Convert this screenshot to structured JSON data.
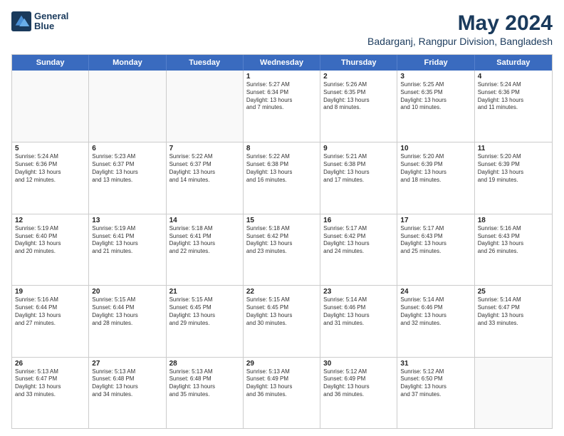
{
  "logo": {
    "line1": "General",
    "line2": "Blue"
  },
  "title": "May 2024",
  "subtitle": "Badarganj, Rangpur Division, Bangladesh",
  "header_days": [
    "Sunday",
    "Monday",
    "Tuesday",
    "Wednesday",
    "Thursday",
    "Friday",
    "Saturday"
  ],
  "weeks": [
    [
      {
        "day": "",
        "lines": [],
        "empty": true
      },
      {
        "day": "",
        "lines": [],
        "empty": true
      },
      {
        "day": "",
        "lines": [],
        "empty": true
      },
      {
        "day": "1",
        "lines": [
          "Sunrise: 5:27 AM",
          "Sunset: 6:34 PM",
          "Daylight: 13 hours",
          "and 7 minutes."
        ],
        "empty": false
      },
      {
        "day": "2",
        "lines": [
          "Sunrise: 5:26 AM",
          "Sunset: 6:35 PM",
          "Daylight: 13 hours",
          "and 8 minutes."
        ],
        "empty": false
      },
      {
        "day": "3",
        "lines": [
          "Sunrise: 5:25 AM",
          "Sunset: 6:35 PM",
          "Daylight: 13 hours",
          "and 10 minutes."
        ],
        "empty": false
      },
      {
        "day": "4",
        "lines": [
          "Sunrise: 5:24 AM",
          "Sunset: 6:36 PM",
          "Daylight: 13 hours",
          "and 11 minutes."
        ],
        "empty": false
      }
    ],
    [
      {
        "day": "5",
        "lines": [
          "Sunrise: 5:24 AM",
          "Sunset: 6:36 PM",
          "Daylight: 13 hours",
          "and 12 minutes."
        ],
        "empty": false
      },
      {
        "day": "6",
        "lines": [
          "Sunrise: 5:23 AM",
          "Sunset: 6:37 PM",
          "Daylight: 13 hours",
          "and 13 minutes."
        ],
        "empty": false
      },
      {
        "day": "7",
        "lines": [
          "Sunrise: 5:22 AM",
          "Sunset: 6:37 PM",
          "Daylight: 13 hours",
          "and 14 minutes."
        ],
        "empty": false
      },
      {
        "day": "8",
        "lines": [
          "Sunrise: 5:22 AM",
          "Sunset: 6:38 PM",
          "Daylight: 13 hours",
          "and 16 minutes."
        ],
        "empty": false
      },
      {
        "day": "9",
        "lines": [
          "Sunrise: 5:21 AM",
          "Sunset: 6:38 PM",
          "Daylight: 13 hours",
          "and 17 minutes."
        ],
        "empty": false
      },
      {
        "day": "10",
        "lines": [
          "Sunrise: 5:20 AM",
          "Sunset: 6:39 PM",
          "Daylight: 13 hours",
          "and 18 minutes."
        ],
        "empty": false
      },
      {
        "day": "11",
        "lines": [
          "Sunrise: 5:20 AM",
          "Sunset: 6:39 PM",
          "Daylight: 13 hours",
          "and 19 minutes."
        ],
        "empty": false
      }
    ],
    [
      {
        "day": "12",
        "lines": [
          "Sunrise: 5:19 AM",
          "Sunset: 6:40 PM",
          "Daylight: 13 hours",
          "and 20 minutes."
        ],
        "empty": false
      },
      {
        "day": "13",
        "lines": [
          "Sunrise: 5:19 AM",
          "Sunset: 6:41 PM",
          "Daylight: 13 hours",
          "and 21 minutes."
        ],
        "empty": false
      },
      {
        "day": "14",
        "lines": [
          "Sunrise: 5:18 AM",
          "Sunset: 6:41 PM",
          "Daylight: 13 hours",
          "and 22 minutes."
        ],
        "empty": false
      },
      {
        "day": "15",
        "lines": [
          "Sunrise: 5:18 AM",
          "Sunset: 6:42 PM",
          "Daylight: 13 hours",
          "and 23 minutes."
        ],
        "empty": false
      },
      {
        "day": "16",
        "lines": [
          "Sunrise: 5:17 AM",
          "Sunset: 6:42 PM",
          "Daylight: 13 hours",
          "and 24 minutes."
        ],
        "empty": false
      },
      {
        "day": "17",
        "lines": [
          "Sunrise: 5:17 AM",
          "Sunset: 6:43 PM",
          "Daylight: 13 hours",
          "and 25 minutes."
        ],
        "empty": false
      },
      {
        "day": "18",
        "lines": [
          "Sunrise: 5:16 AM",
          "Sunset: 6:43 PM",
          "Daylight: 13 hours",
          "and 26 minutes."
        ],
        "empty": false
      }
    ],
    [
      {
        "day": "19",
        "lines": [
          "Sunrise: 5:16 AM",
          "Sunset: 6:44 PM",
          "Daylight: 13 hours",
          "and 27 minutes."
        ],
        "empty": false
      },
      {
        "day": "20",
        "lines": [
          "Sunrise: 5:15 AM",
          "Sunset: 6:44 PM",
          "Daylight: 13 hours",
          "and 28 minutes."
        ],
        "empty": false
      },
      {
        "day": "21",
        "lines": [
          "Sunrise: 5:15 AM",
          "Sunset: 6:45 PM",
          "Daylight: 13 hours",
          "and 29 minutes."
        ],
        "empty": false
      },
      {
        "day": "22",
        "lines": [
          "Sunrise: 5:15 AM",
          "Sunset: 6:45 PM",
          "Daylight: 13 hours",
          "and 30 minutes."
        ],
        "empty": false
      },
      {
        "day": "23",
        "lines": [
          "Sunrise: 5:14 AM",
          "Sunset: 6:46 PM",
          "Daylight: 13 hours",
          "and 31 minutes."
        ],
        "empty": false
      },
      {
        "day": "24",
        "lines": [
          "Sunrise: 5:14 AM",
          "Sunset: 6:46 PM",
          "Daylight: 13 hours",
          "and 32 minutes."
        ],
        "empty": false
      },
      {
        "day": "25",
        "lines": [
          "Sunrise: 5:14 AM",
          "Sunset: 6:47 PM",
          "Daylight: 13 hours",
          "and 33 minutes."
        ],
        "empty": false
      }
    ],
    [
      {
        "day": "26",
        "lines": [
          "Sunrise: 5:13 AM",
          "Sunset: 6:47 PM",
          "Daylight: 13 hours",
          "and 33 minutes."
        ],
        "empty": false
      },
      {
        "day": "27",
        "lines": [
          "Sunrise: 5:13 AM",
          "Sunset: 6:48 PM",
          "Daylight: 13 hours",
          "and 34 minutes."
        ],
        "empty": false
      },
      {
        "day": "28",
        "lines": [
          "Sunrise: 5:13 AM",
          "Sunset: 6:48 PM",
          "Daylight: 13 hours",
          "and 35 minutes."
        ],
        "empty": false
      },
      {
        "day": "29",
        "lines": [
          "Sunrise: 5:13 AM",
          "Sunset: 6:49 PM",
          "Daylight: 13 hours",
          "and 36 minutes."
        ],
        "empty": false
      },
      {
        "day": "30",
        "lines": [
          "Sunrise: 5:12 AM",
          "Sunset: 6:49 PM",
          "Daylight: 13 hours",
          "and 36 minutes."
        ],
        "empty": false
      },
      {
        "day": "31",
        "lines": [
          "Sunrise: 5:12 AM",
          "Sunset: 6:50 PM",
          "Daylight: 13 hours",
          "and 37 minutes."
        ],
        "empty": false
      },
      {
        "day": "",
        "lines": [],
        "empty": true
      }
    ]
  ]
}
